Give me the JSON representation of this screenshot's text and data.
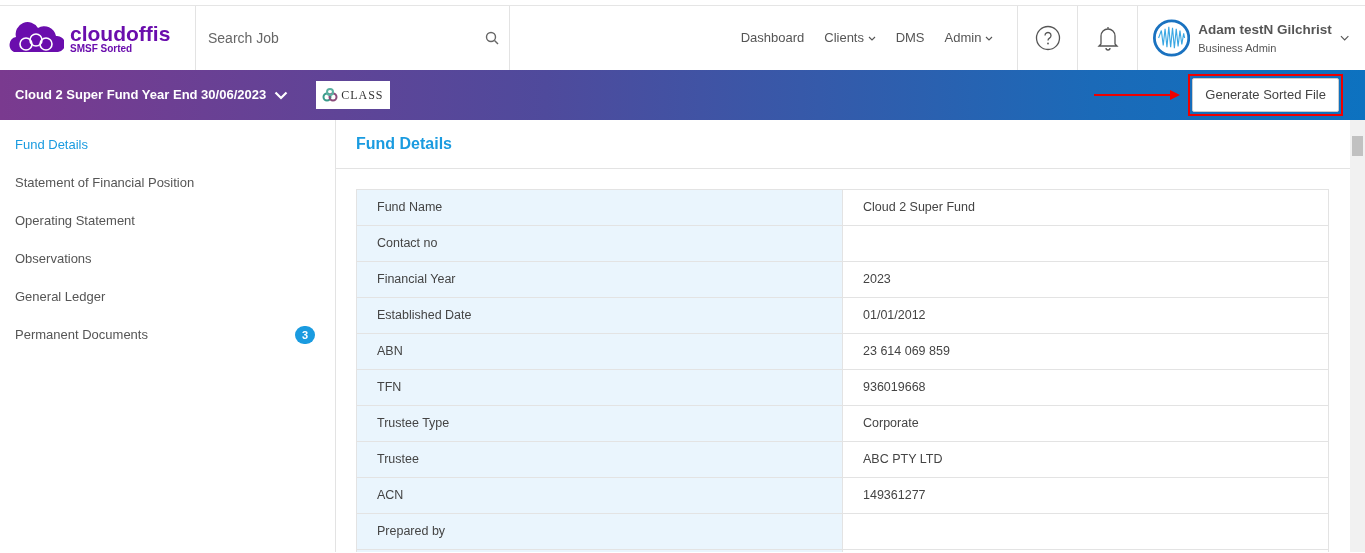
{
  "brand": {
    "name": "cloudoffis",
    "tagline": "SMSF Sorted"
  },
  "search": {
    "placeholder": "Search Job"
  },
  "nav": [
    {
      "label": "Dashboard",
      "dropdown": false
    },
    {
      "label": "Clients",
      "dropdown": true
    },
    {
      "label": "DMS",
      "dropdown": false
    },
    {
      "label": "Admin",
      "dropdown": true
    }
  ],
  "user": {
    "name": "Adam testN Gilchrist",
    "role": "Business Admin"
  },
  "job_bar": {
    "title": "Cloud 2 Super Fund Year End 30/06/2023",
    "badge": "CLASS",
    "action": "Generate Sorted File"
  },
  "sidebar": {
    "items": [
      {
        "label": "Fund Details",
        "selected": true
      },
      {
        "label": "Statement of Financial Position",
        "selected": false
      },
      {
        "label": "Operating Statement",
        "selected": false
      },
      {
        "label": "Observations",
        "selected": false
      },
      {
        "label": "General Ledger",
        "selected": false
      },
      {
        "label": "Permanent Documents",
        "selected": false,
        "count": "3"
      }
    ]
  },
  "panel": {
    "title": "Fund Details",
    "rows": [
      {
        "label": "Fund Name",
        "value": "Cloud 2 Super Fund"
      },
      {
        "label": "Contact no"
      },
      {
        "label": "Financial Year",
        "value": "2023"
      },
      {
        "label": "Established Date",
        "value": "01/01/2012"
      },
      {
        "label": "ABN",
        "value": "23 614 069 859"
      },
      {
        "label": "TFN",
        "value": "936019668"
      },
      {
        "label": "Trustee Type",
        "value": "Corporate"
      },
      {
        "label": "Trustee",
        "value": "ABC PTY LTD"
      },
      {
        "label": "ACN",
        "value": "149361277"
      },
      {
        "label": "Prepared by"
      }
    ]
  }
}
